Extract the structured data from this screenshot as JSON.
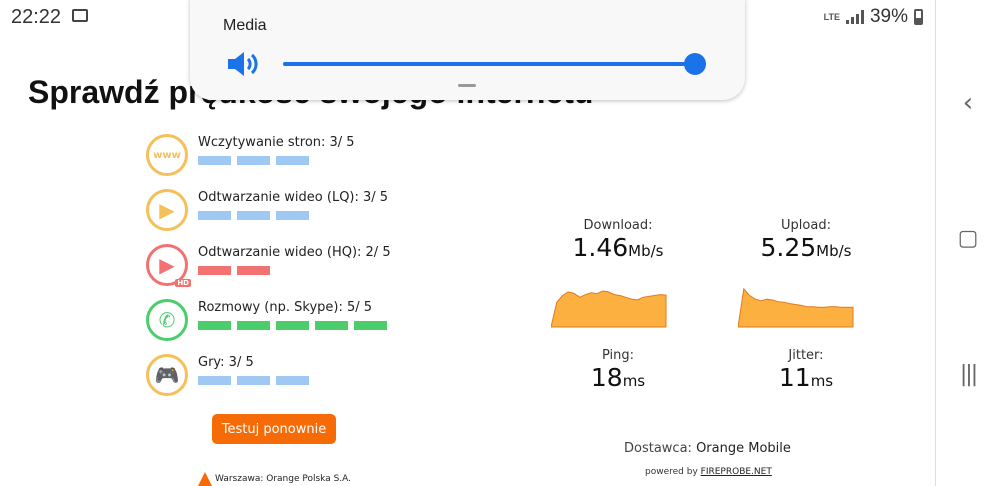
{
  "status_bar": {
    "time": "22:22",
    "network": "LTE",
    "battery": "39%"
  },
  "page": {
    "title": "Sprawdź prędkość swojego internetu"
  },
  "ratings": [
    {
      "label": "Wczytywanie stron: 3/ 5",
      "score": 3,
      "icon": "www-icon",
      "color": "#9fc9f3",
      "ring": "#f5c05a"
    },
    {
      "label": "Odtwarzanie wideo (LQ): 3/ 5",
      "score": 3,
      "icon": "play-icon",
      "color": "#9fc9f3",
      "ring": "#f5c05a"
    },
    {
      "label": "Odtwarzanie wideo (HQ): 2/ 5",
      "score": 2,
      "icon": "play-hd-icon",
      "color": "#f27171",
      "ring": "#f27171"
    },
    {
      "label": "Rozmowy (np. Skype): 5/ 5",
      "score": 5,
      "icon": "phone-icon",
      "color": "#4ccd6b",
      "ring": "#4ccd6b"
    },
    {
      "label": "Gry: 3/ 5",
      "score": 3,
      "icon": "gamepad-icon",
      "color": "#9fc9f3",
      "ring": "#f5c05a"
    }
  ],
  "www_text": "www",
  "hd_text": "HD",
  "retest_button": "Testuj ponownie",
  "server": "Warszawa: Orange Polska S.A.",
  "metrics": {
    "download": {
      "label": "Download:",
      "value": "1.46",
      "unit": "Mb/s",
      "graph": [
        0,
        55,
        70,
        78,
        75,
        66,
        72,
        76,
        74,
        80,
        78,
        72,
        70,
        66,
        62,
        60,
        66,
        68,
        70,
        72,
        71
      ]
    },
    "upload": {
      "label": "Upload:",
      "value": "5.25",
      "unit": "Mb/s",
      "graph": [
        0,
        85,
        70,
        62,
        58,
        62,
        60,
        56,
        55,
        52,
        50,
        48,
        45,
        45,
        44,
        44,
        45,
        45,
        44,
        44,
        44
      ]
    },
    "ping": {
      "label": "Ping:",
      "value": "18",
      "unit": "ms"
    },
    "jitter": {
      "label": "Jitter:",
      "value": "11",
      "unit": "ms"
    }
  },
  "provider": {
    "label": "Dostawca:",
    "name": "Orange Mobile"
  },
  "powered": {
    "prefix": "powered by",
    "link": "FIREPROBE.NET"
  },
  "volume_popup": {
    "title": "Media",
    "level": 1.0
  },
  "colors": {
    "accent": "#f76b07",
    "graph": "#fbb040",
    "slider": "#1a73e8"
  }
}
